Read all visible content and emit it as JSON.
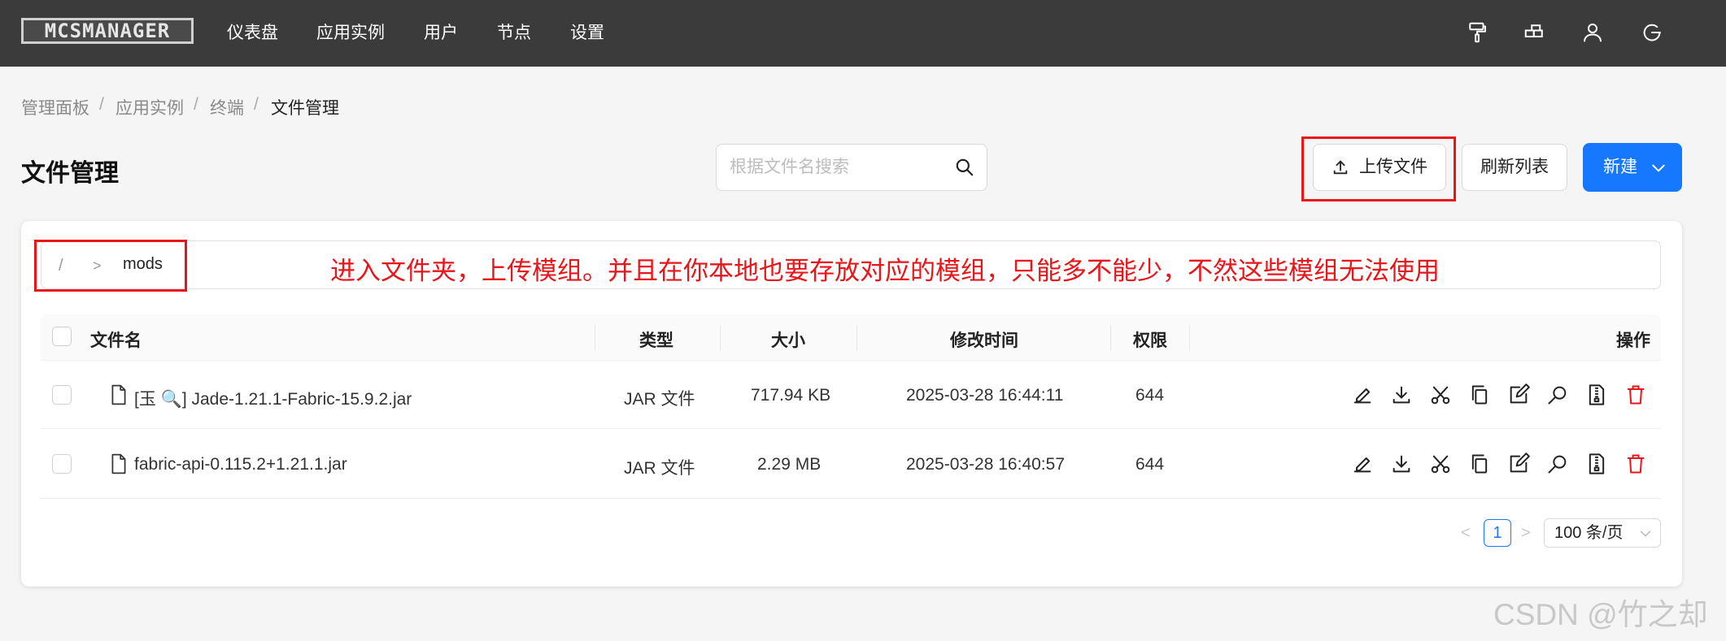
{
  "app": {
    "logo_text": "MCSMANAGER"
  },
  "nav": [
    "仪表盘",
    "应用实例",
    "用户",
    "节点",
    "设置"
  ],
  "top_icons": [
    "paint-roller-icon",
    "layout-icon",
    "user-icon",
    "logout-icon"
  ],
  "breadcrumb": [
    "管理面板",
    "应用实例",
    "终端",
    "文件管理"
  ],
  "breadcrumb_separator": "/",
  "page_title": "文件管理",
  "search": {
    "placeholder": "根据文件名搜索",
    "value": ""
  },
  "toolbar": {
    "upload_label": "上传文件",
    "refresh_label": "刷新列表",
    "new_label": "新建"
  },
  "path": {
    "root": "/",
    "separator": ">",
    "current": "mods"
  },
  "annotation": "进入文件夹，上传模组。并且在你本地也要存放对应的模组，只能多不能少，不然这些模组无法使用",
  "table": {
    "headers": {
      "name": "文件名",
      "type": "类型",
      "size": "大小",
      "modified": "修改时间",
      "permission": "权限",
      "actions": "操作"
    },
    "rows": [
      {
        "name": "[玉 🔍] Jade-1.21.1-Fabric-15.9.2.jar",
        "type": "JAR 文件",
        "size": "717.94 KB",
        "modified": "2025-03-28 16:44:11",
        "permission": "644"
      },
      {
        "name": "fabric-api-0.115.2+1.21.1.jar",
        "type": "JAR 文件",
        "size": "2.29 MB",
        "modified": "2025-03-28 16:40:57",
        "permission": "644"
      }
    ],
    "row_actions": [
      "rename-icon",
      "download-icon",
      "cut-icon",
      "copy-icon",
      "edit-icon",
      "search-icon",
      "archive-icon",
      "delete-icon"
    ]
  },
  "pagination": {
    "prev": "<",
    "current_page": "1",
    "next": ">",
    "page_size": "100 条/页"
  },
  "watermark": "CSDN @竹之却",
  "colors": {
    "topbar": "#3b3b3b",
    "primary": "#1677ff",
    "danger": "#e8151b",
    "background": "#f5f5f5"
  }
}
